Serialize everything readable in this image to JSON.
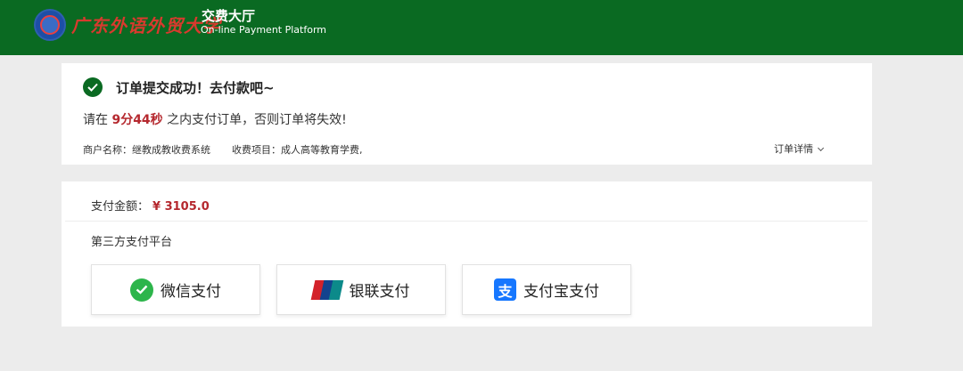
{
  "header": {
    "logo_text": "广东外语外贸大学",
    "title": "交费大厅",
    "subtitle": "On-line Payment Platform"
  },
  "order": {
    "success_title": "订单提交成功！去付款吧~",
    "countdown_prefix": "请在",
    "countdown_time": "9分44秒",
    "countdown_suffix": "之内支付订单，否则订单将失效!",
    "merchant_label": "商户名称：",
    "merchant_value": "继教成教收费系统",
    "item_label": "收费项目：",
    "item_value": "成人高等教育学费,",
    "detail_link": "订单详情"
  },
  "payment": {
    "amount_label": "支付金额：",
    "amount_value": "¥ 3105.0",
    "platform_label": "第三方支付平台",
    "methods": [
      {
        "label": "微信支付",
        "icon": "wechat-icon"
      },
      {
        "label": "银联支付",
        "icon": "unionpay-icon"
      },
      {
        "label": "支付宝支付",
        "icon": "alipay-icon"
      }
    ],
    "alipay_icon_glyph": "支"
  },
  "colors": {
    "header_bg": "#0a6a22",
    "accent_red": "#b5282e",
    "page_bg": "#ececec"
  }
}
